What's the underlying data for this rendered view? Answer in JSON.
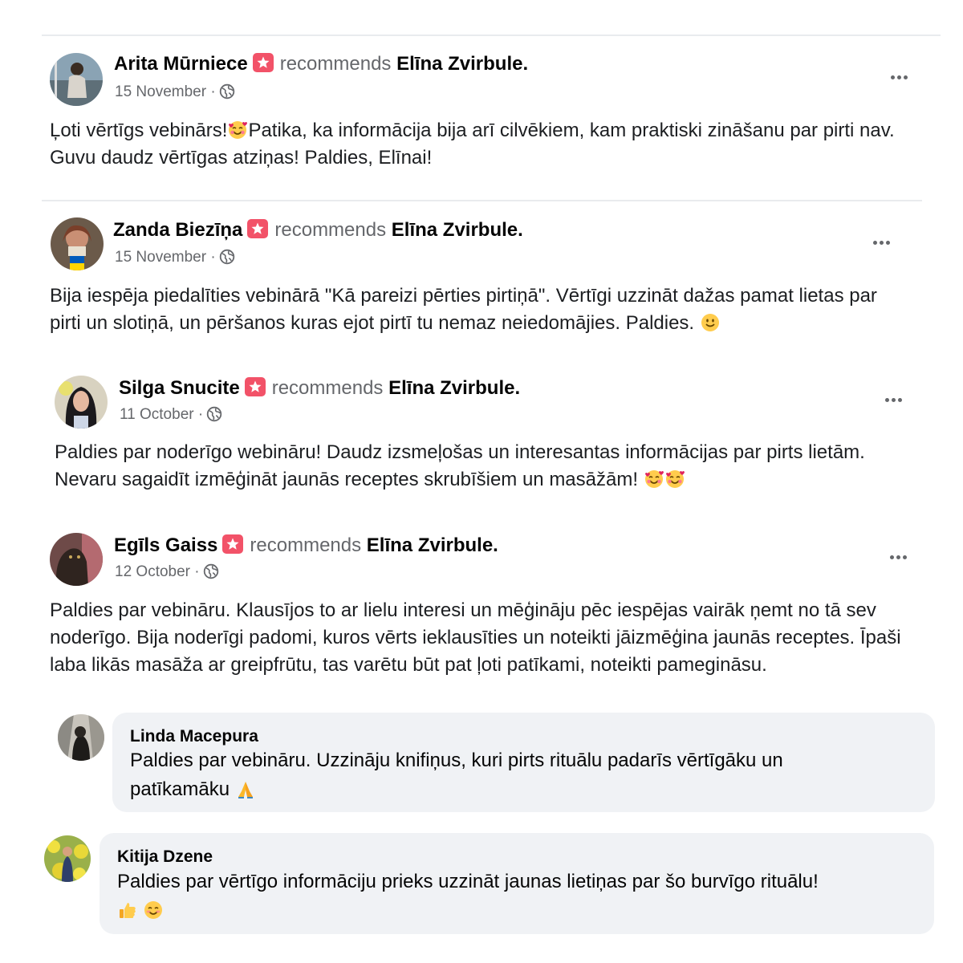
{
  "recommend_word": "recommends",
  "page_name": "Elīna Zvirbule.",
  "badge_color": "#f25268",
  "posts": [
    {
      "author": "Arita Mūrniece",
      "date": "15 November",
      "separator": "·",
      "text": "Ļoti vērtīgs vebinārs!",
      "text2": "Patika, ka informācija bija arī cilvēkiem, kam praktiski zināšanu par pirti nav. Guvu daudz vērtīgas atziņas! Paldies, Elīnai!",
      "emoji": "smiling-face-with-hearts"
    },
    {
      "author": "Zanda Biezīņa",
      "date": "15 November",
      "separator": "·",
      "text": "Bija iespēja piedalīties vebinārā \"Kā pareizi pērties pirtiņā\". Vērtīgi uzzināt dažas  pamat lietas par pirti un slotiņā, un pēršanos kuras ejot pirtī tu nemaz neiedomājies. Paldies.",
      "emoji": "slightly-smiling-face"
    },
    {
      "author": "Silga Snucite",
      "date": "11 October",
      "separator": "·",
      "text": "Paldies par noderīgo webināru! Daudz izsmeļošas un interesantas informācijas par pirts lietām. Nevaru sagaidīt izmēģināt jaunās receptes skrubīšiem un masāžām!",
      "emoji": "smiling-face-with-hearts"
    },
    {
      "author": "Egīls Gaiss",
      "date": "12 October",
      "separator": "·",
      "text": "Paldies par vebināru. Klausījos to ar lielu interesi un mēģināju pēc iespējas vairāk ņemt no tā sev noderīgo. Bija noderīgi padomi, kuros vērts ieklausīties un noteikti jāizmēģina jaunās receptes. Īpaši laba likās masāža ar greipfrūtu, tas varētu būt pat ļoti patīkami,  noteikti pamegināsu."
    }
  ],
  "comments": [
    {
      "author": "Linda Macepura",
      "text": "Paldies par vebināru. Uzzināju knifiņus, kuri pirts rituālu padarīs vērtīgāku un patīkamāku",
      "emoji": "folded-hands"
    },
    {
      "author": "Kitija Dzene",
      "text": "Paldies par vērtīgo informāciju prieks uzzināt jaunas lietiņas par šo burvīgo rituālu!",
      "emoji": "thumbs-up smiling-face"
    }
  ]
}
